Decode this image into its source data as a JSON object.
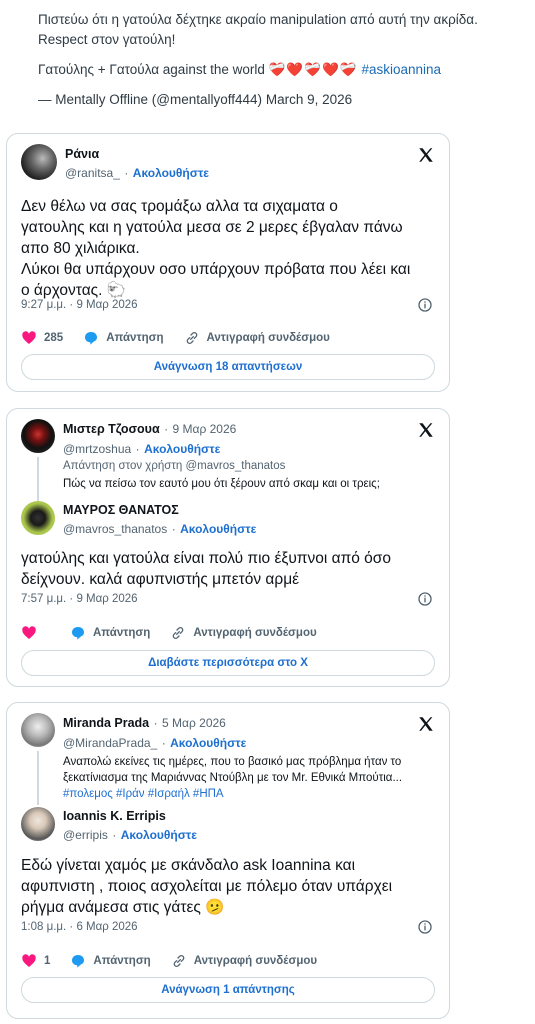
{
  "quote": {
    "line1": "Πιστεύω ότι η γατούλα δέχτηκε ακραίο manipulation από αυτή την ακρίδα.",
    "line2": "Respect στον γατούλη!",
    "line3_text": "Γατούλης + Γατούλα against the world",
    "line3_hearts": "❤️‍🩹❤️❤️‍🩹❤️❤️‍🩹",
    "line3_hashtag": "#askioannina",
    "byline": "— Mentally Offline (@mentallyoff444)",
    "date": "March 9, 2026"
  },
  "tweets": [
    {
      "name": "Ράνια",
      "handle": "@ranitsa_",
      "follow": "Ακολουθήστε",
      "body_l1": "Δεν θέλω να σας τρομάξω αλλα τα σιχαματα ο",
      "body_l2": "γατουλης και η γατούλα μεσα σε 2 μερες έβγαλαν πάνω",
      "body_l3": "απο 80 χιλιάρικα.",
      "body_l4": "Λύκοι θα υπάρχουν οσο υπάρχουν πρόβατα που λέει και",
      "body_l5": "ο άρχοντας. 🐑",
      "timestamp": "9:27 μ.μ. · 9 Μαρ 2026",
      "likes": "285",
      "reply": "Απάντηση",
      "copy": "Αντιγραφή συνδέσμου",
      "button": "Ανάγνωση 18 απαντήσεων"
    },
    {
      "name": "Μιστερ Τζοσουα",
      "date": "9 Μαρ 2026",
      "handle": "@mrtzoshua",
      "follow": "Ακολουθήστε",
      "reply_to": "Απάντηση στον χρήστη @mavros_thanatos",
      "parent_text": "Πώς να πείσω τον εαυτό μου ότι ξέρουν από σκαμ και οι τρεις;",
      "name2": "ΜΑΥΡΟΣ ΘΑΝΑΤΟΣ",
      "handle2": "@mavros_thanatos",
      "follow2": "Ακολουθήστε",
      "body_l1": "γατούλης και γατούλα είναι πολύ πιο έξυπνοι από όσο",
      "body_l2": "δείχνουν. καλά αφυπνιστής μπετόν αρμέ",
      "timestamp": "7:57 μ.μ. · 9 Μαρ 2026",
      "reply": "Απάντηση",
      "copy": "Αντιγραφή συνδέσμου",
      "button": "Διαβάστε περισσότερα στο X"
    },
    {
      "name": "Miranda Prada",
      "date": "5 Μαρ 2026",
      "handle": "@MirandaPrada_",
      "follow": "Ακολουθήστε",
      "parent_l1": "Αναπολώ εκείνες τις ημέρες, που το βασικό μας πρόβλημα ήταν το",
      "parent_l2": "ξεκατίνιασμα της Μαριάννας Ντούβλη με τον Mr. Εθνικά Μπούτια...",
      "parent_tags": "#πολεμος #Ιράν #Ισραήλ #ΗΠΑ",
      "name2": "Ioannis K. Erripis",
      "handle2": "@erripis",
      "follow2": "Ακολουθήστε",
      "body_l1": "Εδώ γίνεται χαμός με σκάνδαλο ask Ioannina και",
      "body_l2": "αφυπνιστη , ποιος ασχολείται με πόλεμο όταν υπάρχει",
      "body_l3": "ρήγμα ανάμεσα στις γάτες 🫤",
      "timestamp": "1:08 μ.μ. · 6 Μαρ 2026",
      "likes": "1",
      "reply": "Απάντηση",
      "copy": "Αντιγραφή συνδέσμου",
      "button": "Ανάγνωση 1 απάντησης"
    }
  ],
  "dot": "·",
  "colors": {
    "heart": "#f91880",
    "reply_bubble": "#1d9bf0",
    "link": "#1d6fd0",
    "border": "#cfd9de"
  }
}
